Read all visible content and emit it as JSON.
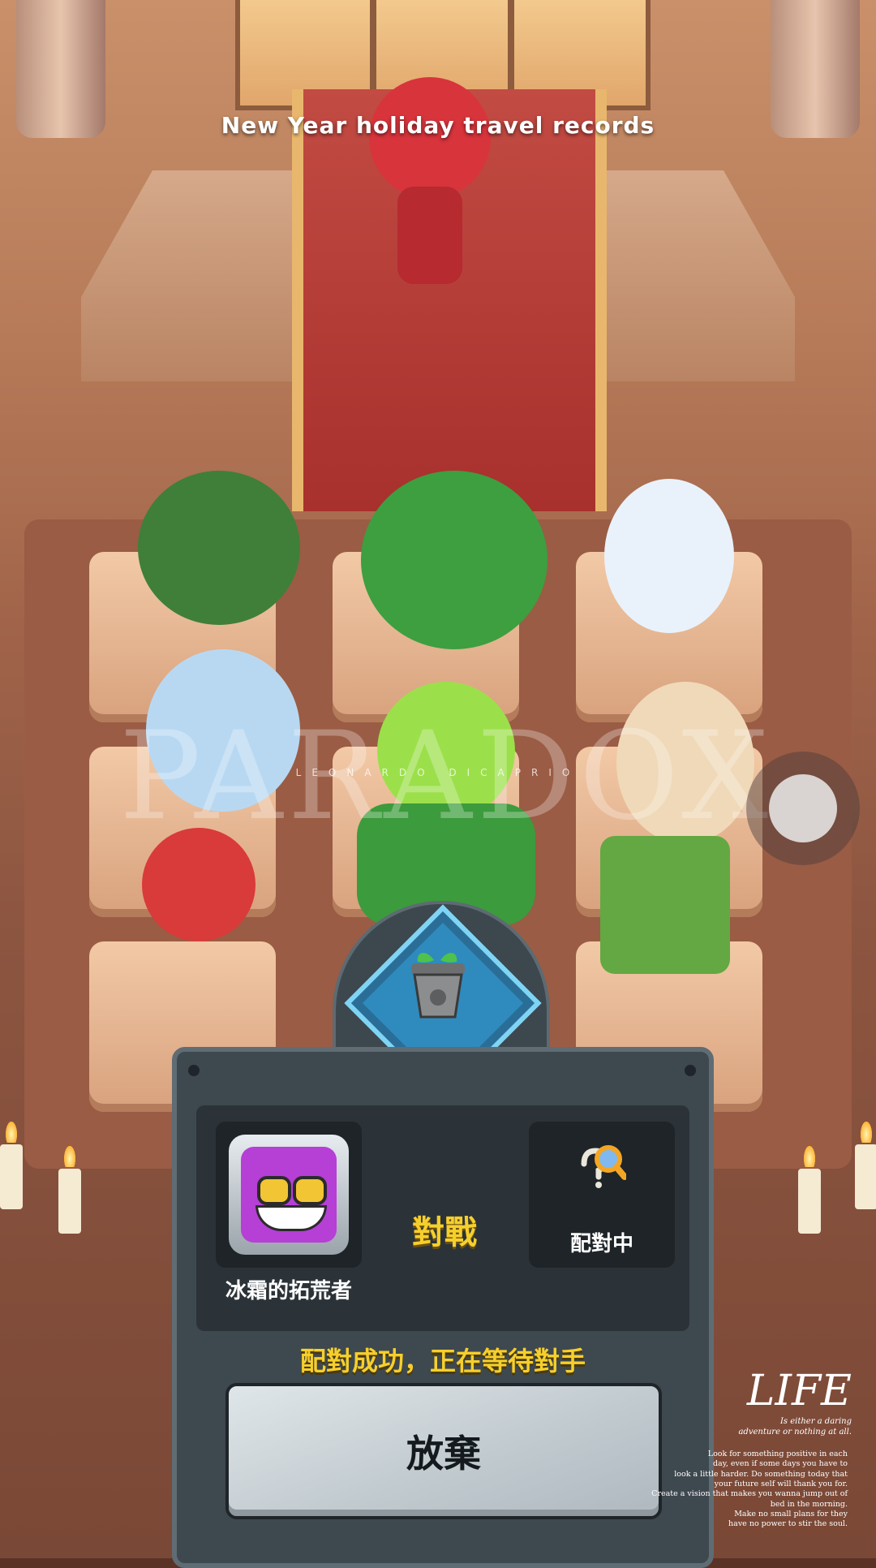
{
  "header": {
    "title": "New Year holiday travel records"
  },
  "watermark": {
    "big": "PARADOX",
    "small": "LEONARDO DICAPRIO"
  },
  "match_panel": {
    "player_name": "冰霜的拓荒者",
    "vs_label": "對戰",
    "opponent_status": "配對中",
    "status_message": "配對成功，正在等待對手",
    "give_up_label": "放棄"
  },
  "overlay": {
    "life_title": "LIFE",
    "life_tagline_1": "Is either a daring",
    "life_tagline_2": "adventure or nothing at all.",
    "quote_lines": [
      "Look for something positive in each",
      "day, even if some days you have to",
      "look a little harder. Do something today that",
      "your future self will thank you for.",
      "Create a vision that makes you wanna jump out of",
      "bed in the morning.",
      "Make no small plans for they",
      "have no power to stir the soul."
    ]
  },
  "icons": [
    "flower-pot-icon",
    "magnifier-icon",
    "player-avatar",
    "floating-assist-button"
  ]
}
